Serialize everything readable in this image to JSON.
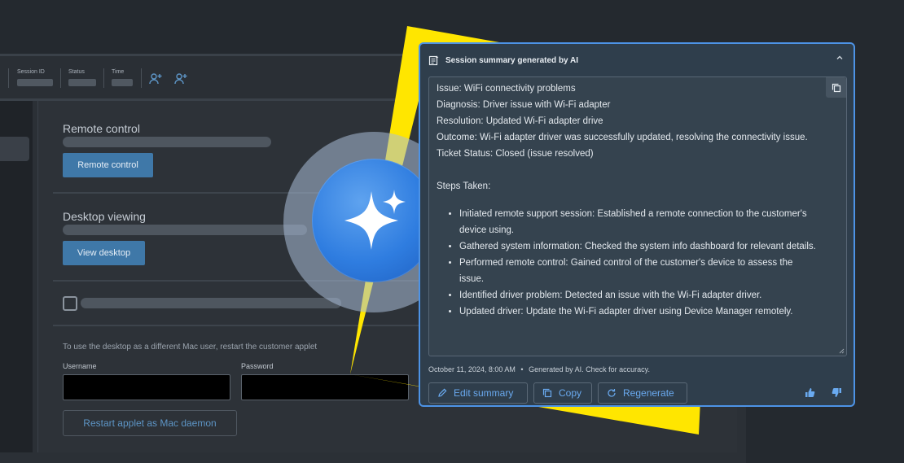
{
  "toolbar": {
    "session_id_label": "Session ID",
    "status_label": "Status",
    "time_label": "Time",
    "icons": [
      "add-person-icon",
      "add-person-icon"
    ]
  },
  "main": {
    "remote_control_title": "Remote control",
    "remote_control_button": "Remote control",
    "desktop_viewing_title": "Desktop viewing",
    "view_desktop_button": "View desktop",
    "mac_user_note": "To use the desktop as a different Mac user, restart the customer applet",
    "username_label": "Username",
    "password_label": "Password",
    "restart_button": "Restart applet as Mac daemon"
  },
  "ai_panel": {
    "title": "Session summary generated by AI",
    "lines": [
      "Issue: WiFi connectivity problems",
      "Diagnosis: Driver issue with Wi-Fi adapter",
      "Resolution: Updated Wi-Fi adapter drive",
      "Outcome: Wi-Fi adapter driver was successfully updated, resolving the connectivity issue.",
      "Ticket Status: Closed (issue resolved)"
    ],
    "steps_heading": "Steps Taken:",
    "steps": [
      "Initiated remote support session: Established a remote connection to the customer's device using.",
      "Gathered system information: Checked the system info dashboard for relevant details.",
      "Performed remote control: Gained control of the customer's device to assess the issue.",
      "Identified driver problem: Detected an issue with the Wi-Fi adapter driver.",
      "Updated driver: Update the Wi-Fi adapter driver using Device Manager remotely."
    ],
    "timestamp": "October 11, 2024, 8:00 AM",
    "separator": "•",
    "disclaimer": "Generated by AI. Check for accuracy.",
    "edit_label": "Edit summary",
    "copy_label": "Copy",
    "regenerate_label": "Regenerate"
  },
  "colors": {
    "accent": "#4d93e6",
    "highlight": "#ffe600",
    "orb": "#2f7de0"
  }
}
